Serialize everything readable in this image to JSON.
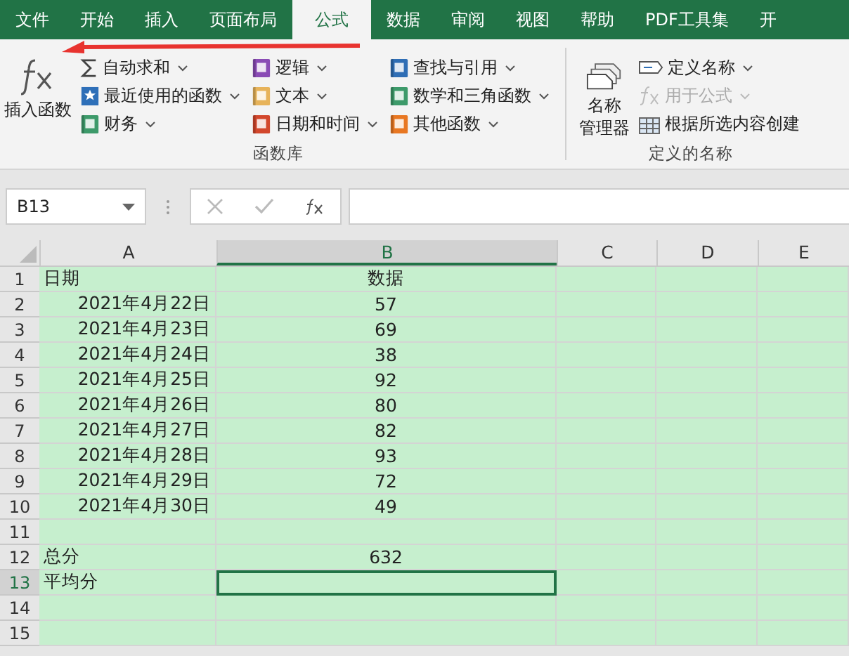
{
  "tabs": [
    {
      "label": "文件",
      "selected": false
    },
    {
      "label": "开始",
      "selected": false
    },
    {
      "label": "插入",
      "selected": false
    },
    {
      "label": "页面布局",
      "selected": false
    },
    {
      "label": "公式",
      "selected": true
    },
    {
      "label": "数据",
      "selected": false
    },
    {
      "label": "审阅",
      "selected": false
    },
    {
      "label": "视图",
      "selected": false
    },
    {
      "label": "帮助",
      "selected": false
    },
    {
      "label": "PDF工具集",
      "selected": false
    },
    {
      "label": "开",
      "selected": false
    }
  ],
  "function_library": {
    "insert_function": "插入函数",
    "label": "函数库",
    "columns": [
      [
        {
          "label": "自动求和",
          "kind": "sum",
          "menu": true
        },
        {
          "label": "最近使用的函数",
          "kind": "star",
          "color": "#2e6fb8",
          "menu": true
        },
        {
          "label": "财务",
          "kind": "book",
          "color": "#3d9a6a",
          "menu": true
        }
      ],
      [
        {
          "label": "逻辑",
          "kind": "book",
          "color": "#8a4bb5",
          "menu": true
        },
        {
          "label": "文本",
          "kind": "book",
          "color": "#e7b35a",
          "menu": true
        },
        {
          "label": "日期和时间",
          "kind": "book",
          "color": "#d2472c",
          "menu": true
        }
      ],
      [
        {
          "label": "查找与引用",
          "kind": "book",
          "color": "#2f6eb5",
          "menu": true
        },
        {
          "label": "数学和三角函数",
          "kind": "book",
          "color": "#3d9a6a",
          "menu": true
        },
        {
          "label": "其他函数",
          "kind": "book",
          "color": "#e87722",
          "menu": true
        }
      ]
    ]
  },
  "defined_names": {
    "manager_lines": [
      "名称",
      "管理器"
    ],
    "label": "定义的名称",
    "items": [
      {
        "label": "定义名称",
        "kind": "tag",
        "menu": true,
        "disabled": false
      },
      {
        "label": "用于公式",
        "kind": "fx",
        "menu": true,
        "disabled": true
      },
      {
        "label": "根据所选内容创建",
        "kind": "grid",
        "menu": false,
        "disabled": false
      }
    ]
  },
  "name_box": "B13",
  "columns": [
    {
      "label": "A",
      "selected": false
    },
    {
      "label": "B",
      "selected": true
    },
    {
      "label": "C",
      "selected": false
    },
    {
      "label": "D",
      "selected": false
    },
    {
      "label": "E",
      "selected": false
    }
  ],
  "rows": [
    {
      "header": "1",
      "selected": false,
      "a": {
        "text": "日期",
        "kind": "text"
      },
      "b": "数据"
    },
    {
      "header": "2",
      "selected": false,
      "a": {
        "text": "2021年4月22日",
        "kind": "date"
      },
      "b": "57"
    },
    {
      "header": "3",
      "selected": false,
      "a": {
        "text": "2021年4月23日",
        "kind": "date"
      },
      "b": "69"
    },
    {
      "header": "4",
      "selected": false,
      "a": {
        "text": "2021年4月24日",
        "kind": "date"
      },
      "b": "38"
    },
    {
      "header": "5",
      "selected": false,
      "a": {
        "text": "2021年4月25日",
        "kind": "date"
      },
      "b": "92"
    },
    {
      "header": "6",
      "selected": false,
      "a": {
        "text": "2021年4月26日",
        "kind": "date"
      },
      "b": "80"
    },
    {
      "header": "7",
      "selected": false,
      "a": {
        "text": "2021年4月27日",
        "kind": "date"
      },
      "b": "82"
    },
    {
      "header": "8",
      "selected": false,
      "a": {
        "text": "2021年4月28日",
        "kind": "date"
      },
      "b": "93"
    },
    {
      "header": "9",
      "selected": false,
      "a": {
        "text": "2021年4月29日",
        "kind": "date"
      },
      "b": "72"
    },
    {
      "header": "10",
      "selected": false,
      "a": {
        "text": "2021年4月30日",
        "kind": "date"
      },
      "b": "49"
    },
    {
      "header": "11",
      "selected": false
    },
    {
      "header": "12",
      "selected": false,
      "a": {
        "text": "总分",
        "kind": "text"
      },
      "b": "632"
    },
    {
      "header": "13",
      "selected": true,
      "a": {
        "text": "平均分",
        "kind": "text"
      }
    },
    {
      "header": "14",
      "selected": false
    },
    {
      "header": "15",
      "selected": false
    }
  ]
}
